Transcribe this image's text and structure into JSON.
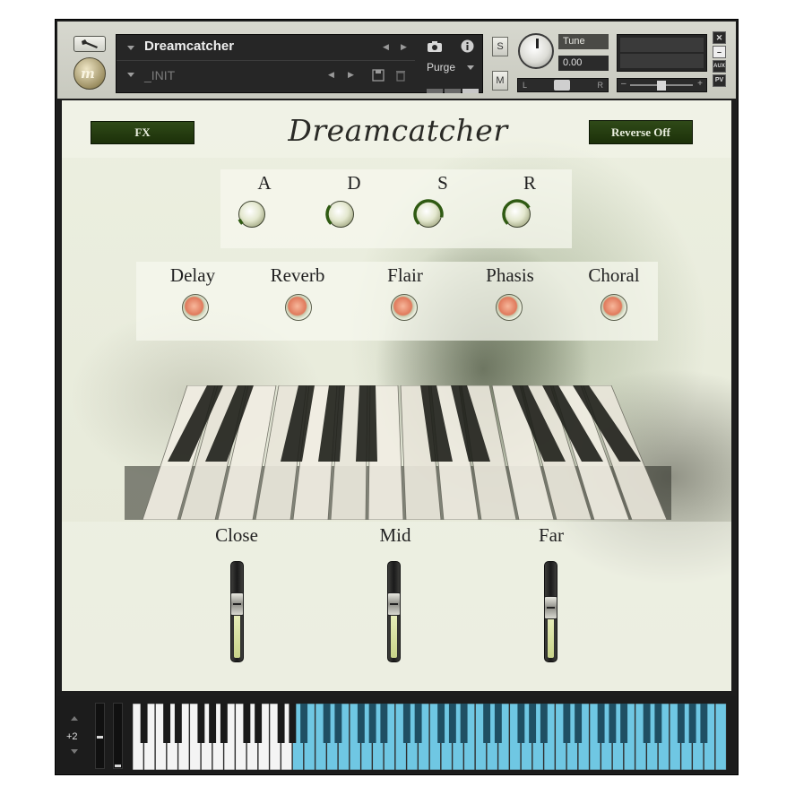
{
  "header": {
    "instrument_name": "Dreamcatcher",
    "preset_name": "_INIT",
    "purge_label": "Purge",
    "solo_label": "S",
    "mute_label": "M",
    "tune_label": "Tune",
    "tune_value": "0.00",
    "pan_left": "L",
    "pan_right": "R",
    "vol_minus": "–",
    "vol_plus": "+",
    "close_label": "✕",
    "minimize_label": "–",
    "aux_label": "AUX",
    "pv_label": "PV"
  },
  "panel": {
    "title": "Dreamcatcher",
    "fx_button": "FX",
    "reverse_button": "Reverse Off",
    "adsr": [
      {
        "label": "A",
        "value": 0.08
      },
      {
        "label": "D",
        "value": 0.3
      },
      {
        "label": "S",
        "value": 0.85
      },
      {
        "label": "R",
        "value": 0.7
      }
    ],
    "effects": [
      {
        "label": "Delay"
      },
      {
        "label": "Reverb"
      },
      {
        "label": "Flair"
      },
      {
        "label": "Phasis"
      },
      {
        "label": "Choral"
      }
    ],
    "faders": [
      {
        "label": "Close",
        "value": 0.6
      },
      {
        "label": "Mid",
        "value": 0.6
      },
      {
        "label": "Far",
        "value": 0.55
      }
    ]
  },
  "keyboard": {
    "octave_shift": "+2",
    "accent_color": "#6fc7e3"
  }
}
